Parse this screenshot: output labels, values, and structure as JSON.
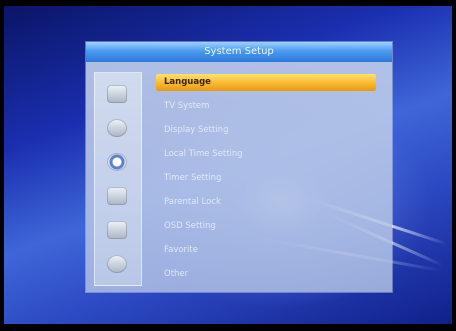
{
  "dialog": {
    "title": "System Setup"
  },
  "sidebar": {
    "icons": [
      {
        "name": "tv-icon"
      },
      {
        "name": "user-icon"
      },
      {
        "name": "gear-icon",
        "active": true
      },
      {
        "name": "lock-icon"
      },
      {
        "name": "satellite-icon"
      },
      {
        "name": "clock-icon"
      }
    ]
  },
  "menu": {
    "items": [
      {
        "label": "Language",
        "selected": true
      },
      {
        "label": "TV System"
      },
      {
        "label": "Display Setting"
      },
      {
        "label": "Local Time Setting"
      },
      {
        "label": "Timer Setting"
      },
      {
        "label": "Parental Lock"
      },
      {
        "label": "OSD Setting"
      },
      {
        "label": "Favorite"
      },
      {
        "label": "Other"
      }
    ]
  },
  "colors": {
    "selection": "#f7b52c",
    "titlebar": "#4b9bf0",
    "background": "#1a2fb0"
  }
}
